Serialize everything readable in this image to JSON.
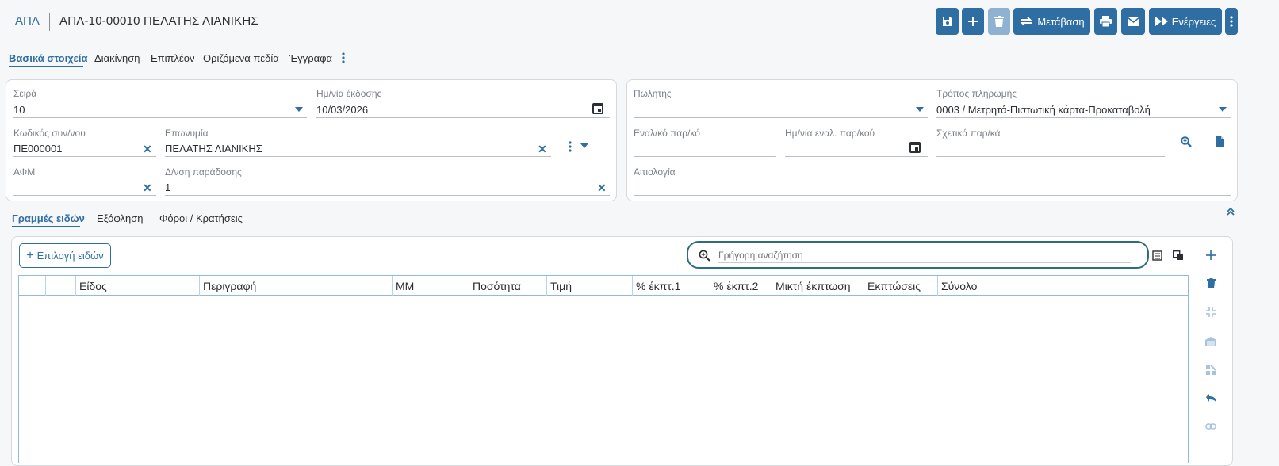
{
  "header": {
    "doc_prefix": "ΑΠΛ",
    "doc_title": "ΑΠΛ-10-00010 ΠΕΛΑΤΗΣ ΛΙΑΝΙΚΗΣ",
    "toolbar": {
      "transition_label": "Μετάβαση",
      "actions_label": "Ενέργειες"
    }
  },
  "main_tabs": [
    "Βασικά στοιχεία",
    "Διακίνηση",
    "Επιπλέον",
    "Οριζόμενα πεδία",
    "Έγγραφα"
  ],
  "left_card": {
    "series": {
      "label": "Σειρά",
      "value": "10"
    },
    "issue_date": {
      "label": "Ημ/νία έκδοσης",
      "value": "10/03/2026"
    },
    "customer_code": {
      "label": "Κωδικός συν/νου",
      "value": "ΠΕ000001"
    },
    "name": {
      "label": "Επωνυμία",
      "value": "ΠΕΛΑΤΗΣ ΛΙΑΝΙΚΗΣ"
    },
    "vat": {
      "label": "ΑΦΜ",
      "value": ""
    },
    "delivery_address": {
      "label": "Δ/νση παράδοσης",
      "value": "1"
    }
  },
  "right_card": {
    "salesperson": {
      "label": "Πωλητής",
      "value": ""
    },
    "payment_method": {
      "label": "Τρόπος πληρωμής",
      "value": "0003 / Μετρητά-Πιστωτική κάρτα-Προκαταβολή"
    },
    "alt_doc": {
      "label": "Εναλ/κό παρ/κό",
      "value": ""
    },
    "alt_doc_date": {
      "label": "Ημ/νία εναλ. παρ/κού",
      "value": ""
    },
    "related_docs": {
      "label": "Σχετικά παρ/κά",
      "value": ""
    },
    "reason": {
      "label": "Αιτιολογία",
      "value": ""
    }
  },
  "sub_tabs": [
    "Γραμμές ειδών",
    "Εξόφληση",
    "Φόροι / Κρατήσεις"
  ],
  "lines": {
    "select_items_label": "Επιλογή ειδών",
    "search_placeholder": "Γρήγορη αναζήτηση",
    "columns": [
      "",
      "",
      "Είδος",
      "Περιγραφή",
      "ΜΜ",
      "Ποσότητα",
      "Τιμή",
      "% έκπτ.1",
      "% έκπτ.2",
      "Μικτή έκπτωση",
      "Εκπτώσεις",
      "Σύνολο"
    ]
  },
  "colors": {
    "accent": "#2f6ea3",
    "search_border": "#2e6e78"
  }
}
